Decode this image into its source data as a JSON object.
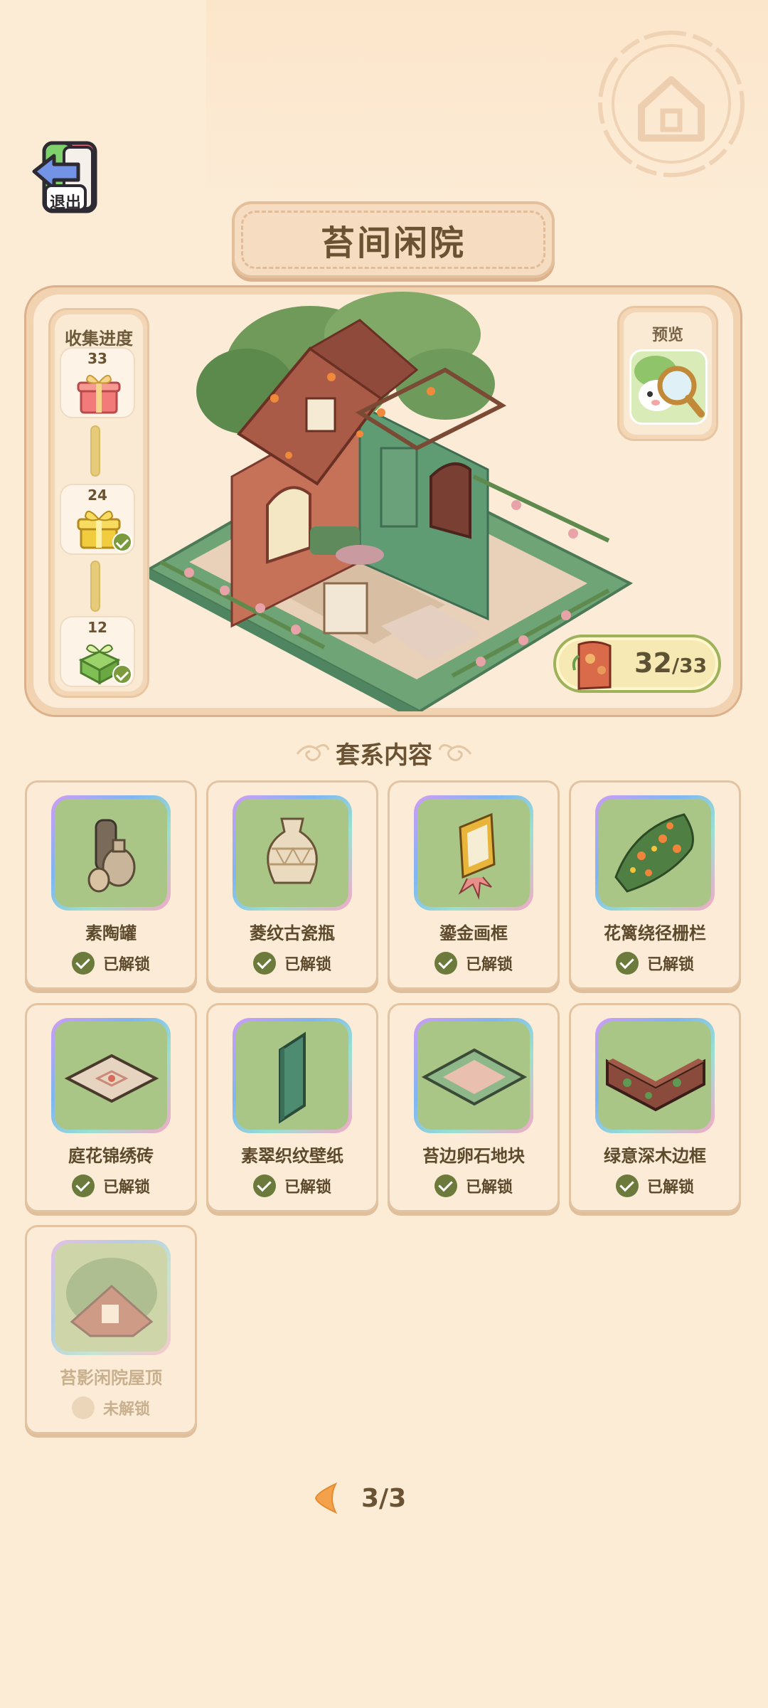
{
  "header": {
    "exit_label": "退出",
    "title": "苔间闲院"
  },
  "progress": {
    "title": "收集进度",
    "milestones": [
      {
        "threshold": "33",
        "reward_icon": "red-gift-icon",
        "claimed": false
      },
      {
        "threshold": "24",
        "reward_icon": "gold-gift-icon",
        "claimed": true
      },
      {
        "threshold": "12",
        "reward_icon": "green-gift-icon",
        "claimed": true
      }
    ]
  },
  "preview": {
    "label": "预览"
  },
  "collection_count": {
    "current": "32",
    "total": "/33"
  },
  "section": {
    "title": "套系内容"
  },
  "items": [
    {
      "name": "素陶罐",
      "status": "已解锁",
      "icon": "clay-pots-icon",
      "unlocked": true
    },
    {
      "name": "菱纹古瓷瓶",
      "status": "已解锁",
      "icon": "diamond-vase-icon",
      "unlocked": true
    },
    {
      "name": "鎏金画框",
      "status": "已解锁",
      "icon": "gold-frame-icon",
      "unlocked": true
    },
    {
      "name": "花篱绕径栅栏",
      "status": "已解锁",
      "icon": "flower-fence-icon",
      "unlocked": true
    },
    {
      "name": "庭花锦绣砖",
      "status": "已解锁",
      "icon": "embroidered-tile-icon",
      "unlocked": true
    },
    {
      "name": "素翠织纹壁纸",
      "status": "已解锁",
      "icon": "green-wallpaper-icon",
      "unlocked": true
    },
    {
      "name": "苔边卵石地块",
      "status": "已解锁",
      "icon": "pebble-floor-icon",
      "unlocked": true
    },
    {
      "name": "绿意深木边框",
      "status": "已解锁",
      "icon": "wood-border-icon",
      "unlocked": true
    },
    {
      "name": "苔影闲院屋顶",
      "status": "未解锁",
      "icon": "mossy-roof-icon",
      "unlocked": false
    }
  ],
  "pager": {
    "text": "3/3"
  },
  "colors": {
    "background": "#fcecd6",
    "accent_green": "#6c7b3b",
    "title_brown": "#6a5232",
    "badge_border": "#9db25a"
  }
}
